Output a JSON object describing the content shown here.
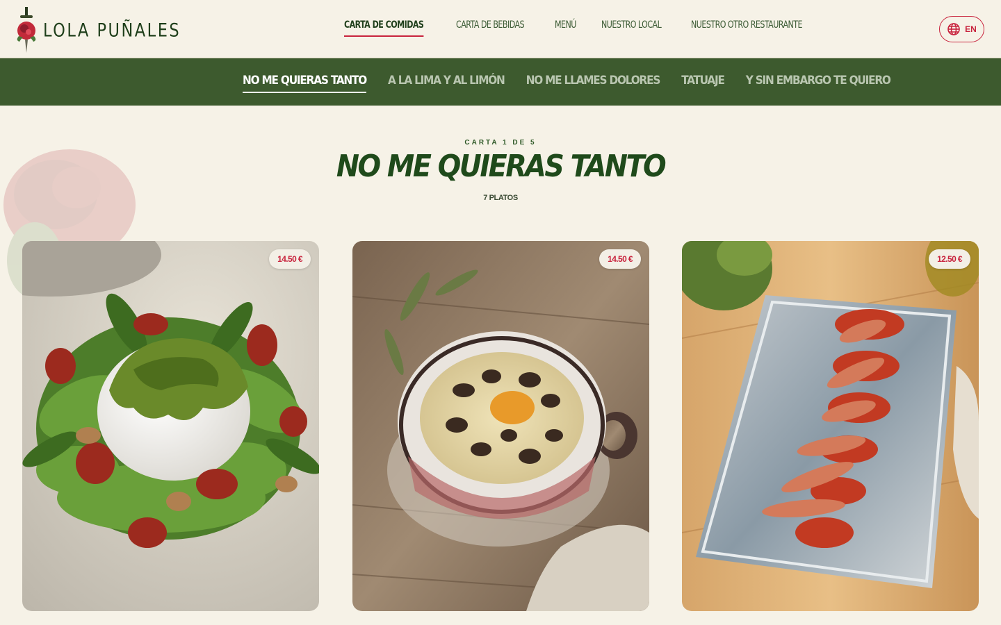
{
  "brand": {
    "name": "LOLA PUÑALES"
  },
  "main_nav": [
    {
      "label": "CARTA DE COMIDAS",
      "active": true
    },
    {
      "label": "CARTA DE BEBIDAS",
      "active": false
    },
    {
      "label": "MENÚ",
      "active": false
    },
    {
      "label": "NUESTRO LOCAL",
      "active": false
    },
    {
      "label": "NUESTRO OTRO RESTAURANTE",
      "active": false
    }
  ],
  "language": {
    "label": "EN",
    "icon": "globe-icon"
  },
  "categories": [
    {
      "label": "NO ME QUIERAS TANTO",
      "active": true
    },
    {
      "label": "A LA LIMA Y AL LIMÓN",
      "active": false
    },
    {
      "label": "NO ME LLAMES DOLORES",
      "active": false
    },
    {
      "label": "TATUAJE",
      "active": false
    },
    {
      "label": "Y SIN EMBARGO TE QUIERO",
      "active": false
    }
  ],
  "section": {
    "eyebrow": "CARTA 1 DE 5",
    "title": "NO ME QUIERAS TANTO",
    "count": "7 PLATOS"
  },
  "dishes": [
    {
      "price": "14.50 €",
      "photo": "burrata-salad"
    },
    {
      "price": "14.50 €",
      "photo": "egg-mushroom-bowl"
    },
    {
      "price": "12.50 €",
      "photo": "tuna-tomato-plate"
    }
  ],
  "colors": {
    "background": "#f6f2e7",
    "brand_green": "#3d5a2e",
    "accent_red": "#c8233d"
  }
}
